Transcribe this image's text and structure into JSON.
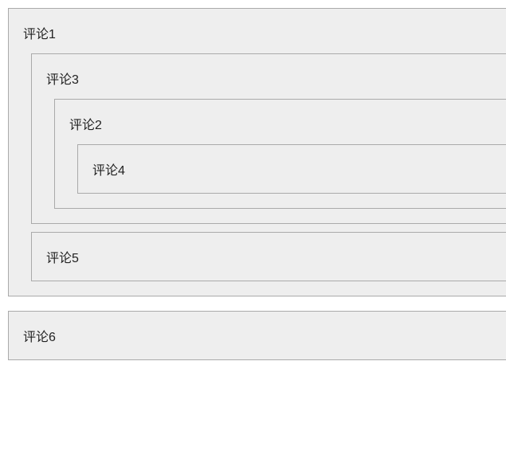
{
  "comments": [
    {
      "id": "c1",
      "label": "评论1",
      "children": [
        {
          "id": "c3",
          "label": "评论3",
          "children": [
            {
              "id": "c2",
              "label": "评论2",
              "children": [
                {
                  "id": "c4",
                  "label": "评论4",
                  "children": []
                }
              ]
            }
          ]
        },
        {
          "id": "c5",
          "label": "评论5",
          "children": []
        }
      ]
    },
    {
      "id": "c6",
      "label": "评论6",
      "children": []
    }
  ]
}
